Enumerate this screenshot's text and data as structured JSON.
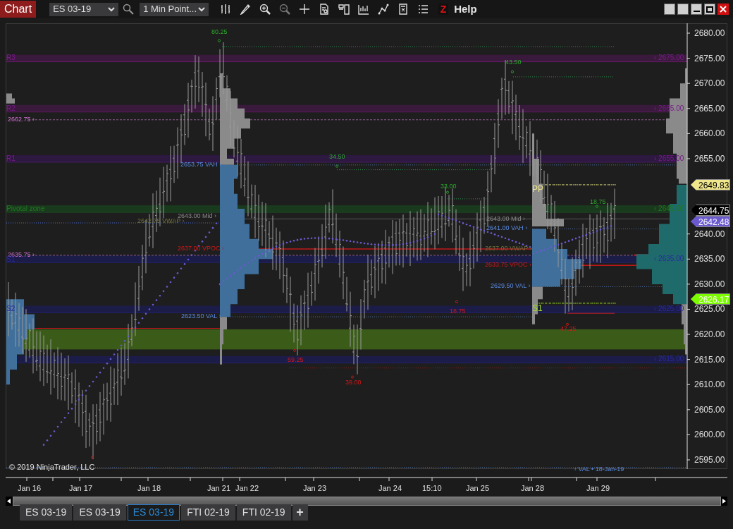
{
  "toolbar": {
    "title": "Chart",
    "instrument": "ES 03-19",
    "period": "1 Min Point...",
    "z_label": "Z",
    "help": "Help"
  },
  "chart": {
    "y_ticks": [
      "2680.00",
      "2675.00",
      "2670.00",
      "2665.00",
      "2660.00",
      "2655.00",
      "2640.00",
      "2635.00",
      "2630.00",
      "2625.00",
      "2620.00",
      "2615.00",
      "2610.00",
      "2605.00",
      "2600.00",
      "2595.00"
    ],
    "price_tags": [
      {
        "text": "2649.83",
        "color": "#f0e68c"
      },
      {
        "text": "2644.75",
        "color": "#000000"
      },
      {
        "text": "2642.48",
        "color": "#6a5acd"
      },
      {
        "text": "2626.17",
        "color": "#7cfc00"
      }
    ],
    "level_labels": [
      {
        "text": "R3",
        "kind": "pivot"
      },
      {
        "text": "R2",
        "kind": "pivot"
      },
      {
        "text": "2662.75 ›",
        "kind": "pink"
      },
      {
        "text": "R1",
        "kind": "pivot"
      },
      {
        "text": "Pivotal zone",
        "kind": "zone"
      },
      {
        "text": "2635.75 ›",
        "kind": "pink"
      },
      {
        "text": "S1",
        "kind": "support"
      },
      {
        "text": "S2",
        "kind": "support"
      },
      {
        "text": "2653.75 VAH ›",
        "kind": "va"
      },
      {
        "text": "2643.00 Mid ›",
        "kind": "mid"
      },
      {
        "text": "2642.75 VWAP ›",
        "kind": "vwap"
      },
      {
        "text": "2637.00 VPOC ›",
        "kind": "vpoc"
      },
      {
        "text": "2623.50 VAL ›",
        "kind": "va"
      },
      {
        "text": "2643.00 Mid ›",
        "kind": "mid"
      },
      {
        "text": "2641.00 VAH ›",
        "kind": "va"
      },
      {
        "text": "2637.00 VWAP ›",
        "kind": "vwap"
      },
      {
        "text": "2633.75 VPOC ›",
        "kind": "vpoc"
      },
      {
        "text": "2629.50 VAL ›",
        "kind": "va"
      },
      {
        "text": "PP",
        "kind": "pp"
      },
      {
        "text": "S1",
        "kind": "s1"
      },
      {
        "text": "80.25",
        "kind": "swing_high"
      },
      {
        "text": "34.50",
        "kind": "swing_high"
      },
      {
        "text": "33.00",
        "kind": "swing_high"
      },
      {
        "text": "43.50",
        "kind": "swing_high"
      },
      {
        "text": "18.75",
        "kind": "swing_high"
      },
      {
        "text": "59.25",
        "kind": "swing_low"
      },
      {
        "text": "39.00",
        "kind": "swing_low"
      },
      {
        "text": "18.75",
        "kind": "swing_low"
      },
      {
        "text": "47.25",
        "kind": "swing_low"
      },
      {
        "text": "‹ 2675.00",
        "kind": "pivot"
      },
      {
        "text": "‹ 2665.00",
        "kind": "pivot"
      },
      {
        "text": "‹ 2655.00",
        "kind": "pivot"
      },
      {
        "text": "‹ 2645.00",
        "kind": "zone"
      },
      {
        "text": "‹ 2635.00",
        "kind": "support"
      },
      {
        "text": "‹ 2625.00",
        "kind": "support"
      },
      {
        "text": "‹ 2615.00",
        "kind": "support"
      },
      {
        "text": "‹ VAL • 18-Jan-19",
        "kind": "va"
      }
    ],
    "copyright": "© 2019 NinjaTrader, LLC",
    "x_labels": [
      "Jan 16",
      "Jan 17",
      "Jan 18",
      "Jan 21",
      "Jan 22",
      "Jan 23",
      "Jan 24",
      "15:10",
      "Jan 25",
      "Jan 28",
      "Jan 29"
    ]
  },
  "tabs": [
    {
      "label": "ES 03-19",
      "selected": false
    },
    {
      "label": "ES 03-19",
      "selected": false
    },
    {
      "label": "ES 03-19",
      "selected": true
    },
    {
      "label": "FTI 02-19",
      "selected": false
    },
    {
      "label": "FTI 02-19",
      "selected": false
    }
  ],
  "add_tab": "+"
}
